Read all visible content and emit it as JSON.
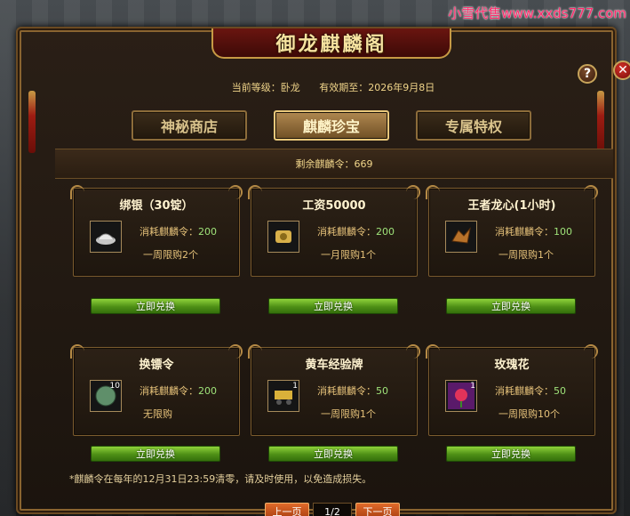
{
  "watermark": "小雪代售www.xxds777.com",
  "window": {
    "title": "御龙麒麟阁",
    "help_glyph": "?",
    "close_glyph": "✕"
  },
  "status": {
    "level_label": "当前等级：卧龙",
    "expiry_label": "有效期至：2026年9月8日"
  },
  "tabs": [
    {
      "label": "神秘商店",
      "active": false
    },
    {
      "label": "麒麟珍宝",
      "active": true
    },
    {
      "label": "专属特权",
      "active": false
    }
  ],
  "remaining": "剩余麒麟令：669",
  "items": [
    {
      "name": "绑银（30锭）",
      "icon": "silver-ingot-icon",
      "cost_label": "消耗麒麟令：",
      "cost": "200",
      "limit": "一周限购2个",
      "qty": "",
      "button": "立即兑换"
    },
    {
      "name": "工资50000",
      "icon": "salary-scroll-icon",
      "cost_label": "消耗麒麟令：",
      "cost": "200",
      "limit": "一月限购1个",
      "qty": "",
      "button": "立即兑换"
    },
    {
      "name": "王者龙心(1小时)",
      "icon": "dragon-heart-icon",
      "cost_label": "消耗麒麟令：",
      "cost": "100",
      "limit": "一周限购1个",
      "qty": "",
      "button": "立即兑换"
    },
    {
      "name": "换镖令",
      "icon": "escort-token-icon",
      "cost_label": "消耗麒麟令：",
      "cost": "200",
      "limit": "无限购",
      "qty": "10",
      "button": "立即兑换"
    },
    {
      "name": "黄车经验牌",
      "icon": "yellow-cart-exp-icon",
      "cost_label": "消耗麒麟令：",
      "cost": "50",
      "limit": "一周限购1个",
      "qty": "1",
      "button": "立即兑换"
    },
    {
      "name": "玫瑰花",
      "icon": "rose-icon",
      "cost_label": "消耗麒麟令：",
      "cost": "50",
      "limit": "一周限购10个",
      "qty": "1",
      "button": "立即兑换"
    }
  ],
  "note": "*麒麟令在每年的12月31日23:59清零，请及时使用，以免造成损失。",
  "pager": {
    "prev": "上一页",
    "info": "1/2",
    "next": "下一页"
  }
}
